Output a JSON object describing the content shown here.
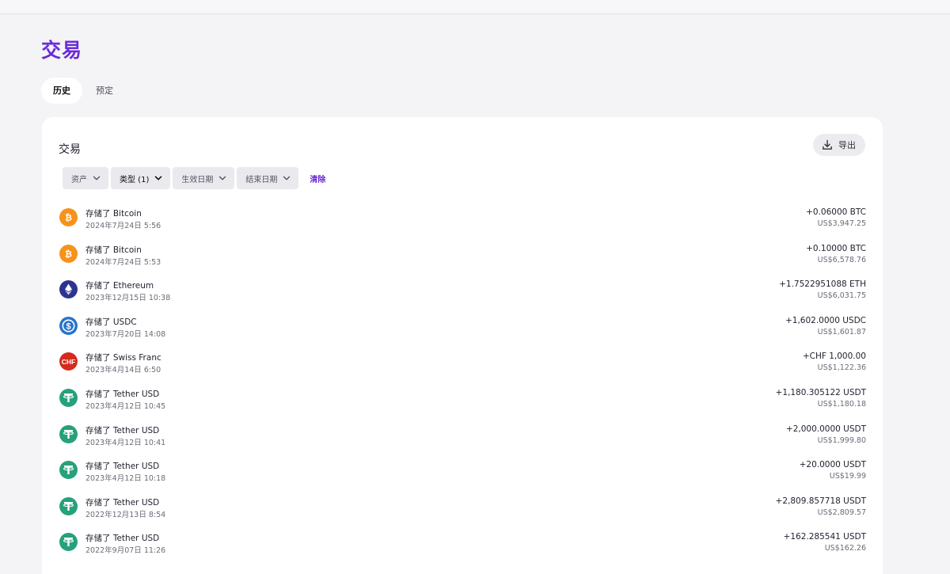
{
  "header": {
    "title": "交易"
  },
  "tabs": [
    {
      "label": "历史",
      "active": true
    },
    {
      "label": "预定",
      "active": false
    }
  ],
  "card": {
    "title": "交易",
    "export_label": "导出",
    "filters": [
      {
        "label": "资产"
      },
      {
        "label": "类型 (1)"
      },
      {
        "label": "生效日期"
      },
      {
        "label": "结束日期"
      }
    ],
    "clear_label": "清除"
  },
  "transactions": [
    {
      "title": "存储了 Bitcoin",
      "date": "2024年7月24日 5:56",
      "amount": "+0.06000 BTC",
      "fiat": "US$3,947.25",
      "icon": "bitcoin-icon",
      "color": "#f7931a"
    },
    {
      "title": "存储了 Bitcoin",
      "date": "2024年7月24日 5:53",
      "amount": "+0.10000 BTC",
      "fiat": "US$6,578.76",
      "icon": "bitcoin-icon",
      "color": "#f7931a"
    },
    {
      "title": "存储了 Ethereum",
      "date": "2023年12月15日 10:38",
      "amount": "+1.7522951088 ETH",
      "fiat": "US$6,031.75",
      "icon": "ethereum-icon",
      "color": "#2d3391"
    },
    {
      "title": "存储了 USDC",
      "date": "2023年7月20日 14:08",
      "amount": "+1,602.0000 USDC",
      "fiat": "US$1,601.87",
      "icon": "usdc-icon",
      "color": "#2775ca"
    },
    {
      "title": "存储了 Swiss Franc",
      "date": "2023年4月14日 6:50",
      "amount": "+CHF 1,000.00",
      "fiat": "US$1,122.36",
      "icon": "swiss-franc-icon",
      "color": "#d52b1e"
    },
    {
      "title": "存储了 Tether USD",
      "date": "2023年4月12日 10:45",
      "amount": "+1,180.305122 USDT",
      "fiat": "US$1,180.18",
      "icon": "tether-icon",
      "color": "#26a17b"
    },
    {
      "title": "存储了 Tether USD",
      "date": "2023年4月12日 10:41",
      "amount": "+2,000.0000 USDT",
      "fiat": "US$1,999.80",
      "icon": "tether-icon",
      "color": "#26a17b"
    },
    {
      "title": "存储了 Tether USD",
      "date": "2023年4月12日 10:18",
      "amount": "+20.0000 USDT",
      "fiat": "US$19.99",
      "icon": "tether-icon",
      "color": "#26a17b"
    },
    {
      "title": "存储了 Tether USD",
      "date": "2022年12月13日 8:54",
      "amount": "+2,809.857718 USDT",
      "fiat": "US$2,809.57",
      "icon": "tether-icon",
      "color": "#26a17b"
    },
    {
      "title": "存储了 Tether USD",
      "date": "2022年9月07日 11:26",
      "amount": "+162.285541 USDT",
      "fiat": "US$162.26",
      "icon": "tether-icon",
      "color": "#26a17b"
    }
  ],
  "colors": {
    "accent": "#6b2bd9",
    "background": "#f4f4f7",
    "card": "#ffffff"
  }
}
